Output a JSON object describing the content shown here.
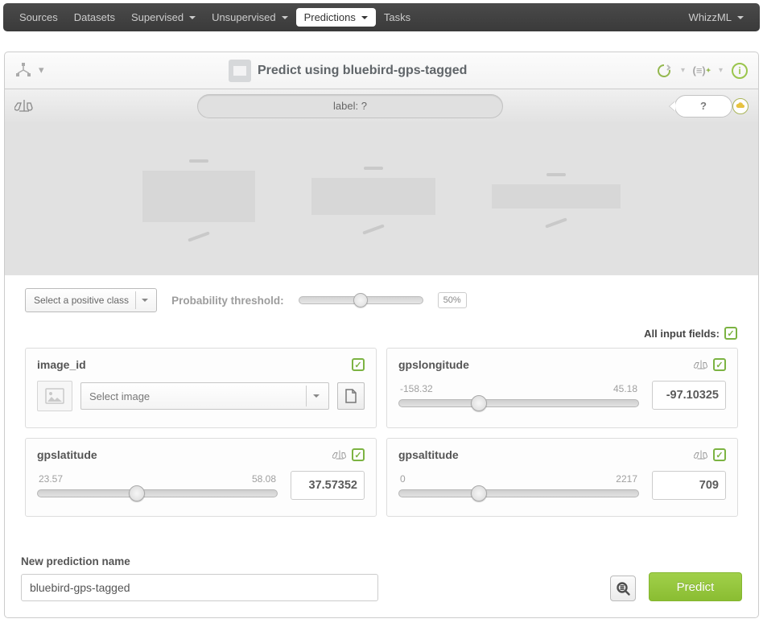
{
  "nav": {
    "sources": "Sources",
    "datasets": "Datasets",
    "supervised": "Supervised",
    "unsupervised": "Unsupervised",
    "predictions": "Predictions",
    "tasks": "Tasks",
    "whizzml": "WhizzML"
  },
  "header": {
    "title": "Predict using bluebird-gps-tagged"
  },
  "label_row": {
    "label_text": "label: ?",
    "question": "?"
  },
  "threshold": {
    "positive_class_placeholder": "Select a positive class",
    "label": "Probability threshold:",
    "percent": "50%",
    "knob_left_pct": 44
  },
  "all_fields_label": "All input fields:",
  "fields": {
    "image_id": {
      "label": "image_id",
      "select_placeholder": "Select image"
    },
    "gpslongitude": {
      "label": "gpslongitude",
      "min": "-158.32",
      "max": "45.18",
      "value": "-97.10325",
      "knob_pct": 30
    },
    "gpslatitude": {
      "label": "gpslatitude",
      "min": "23.57",
      "max": "58.08",
      "value": "37.57352",
      "knob_pct": 38
    },
    "gpsaltitude": {
      "label": "gpsaltitude",
      "min": "0",
      "max": "2217",
      "value": "709",
      "knob_pct": 30
    }
  },
  "footer": {
    "label": "New prediction name",
    "name_value": "bluebird-gps-tagged",
    "predict_label": "Predict"
  }
}
